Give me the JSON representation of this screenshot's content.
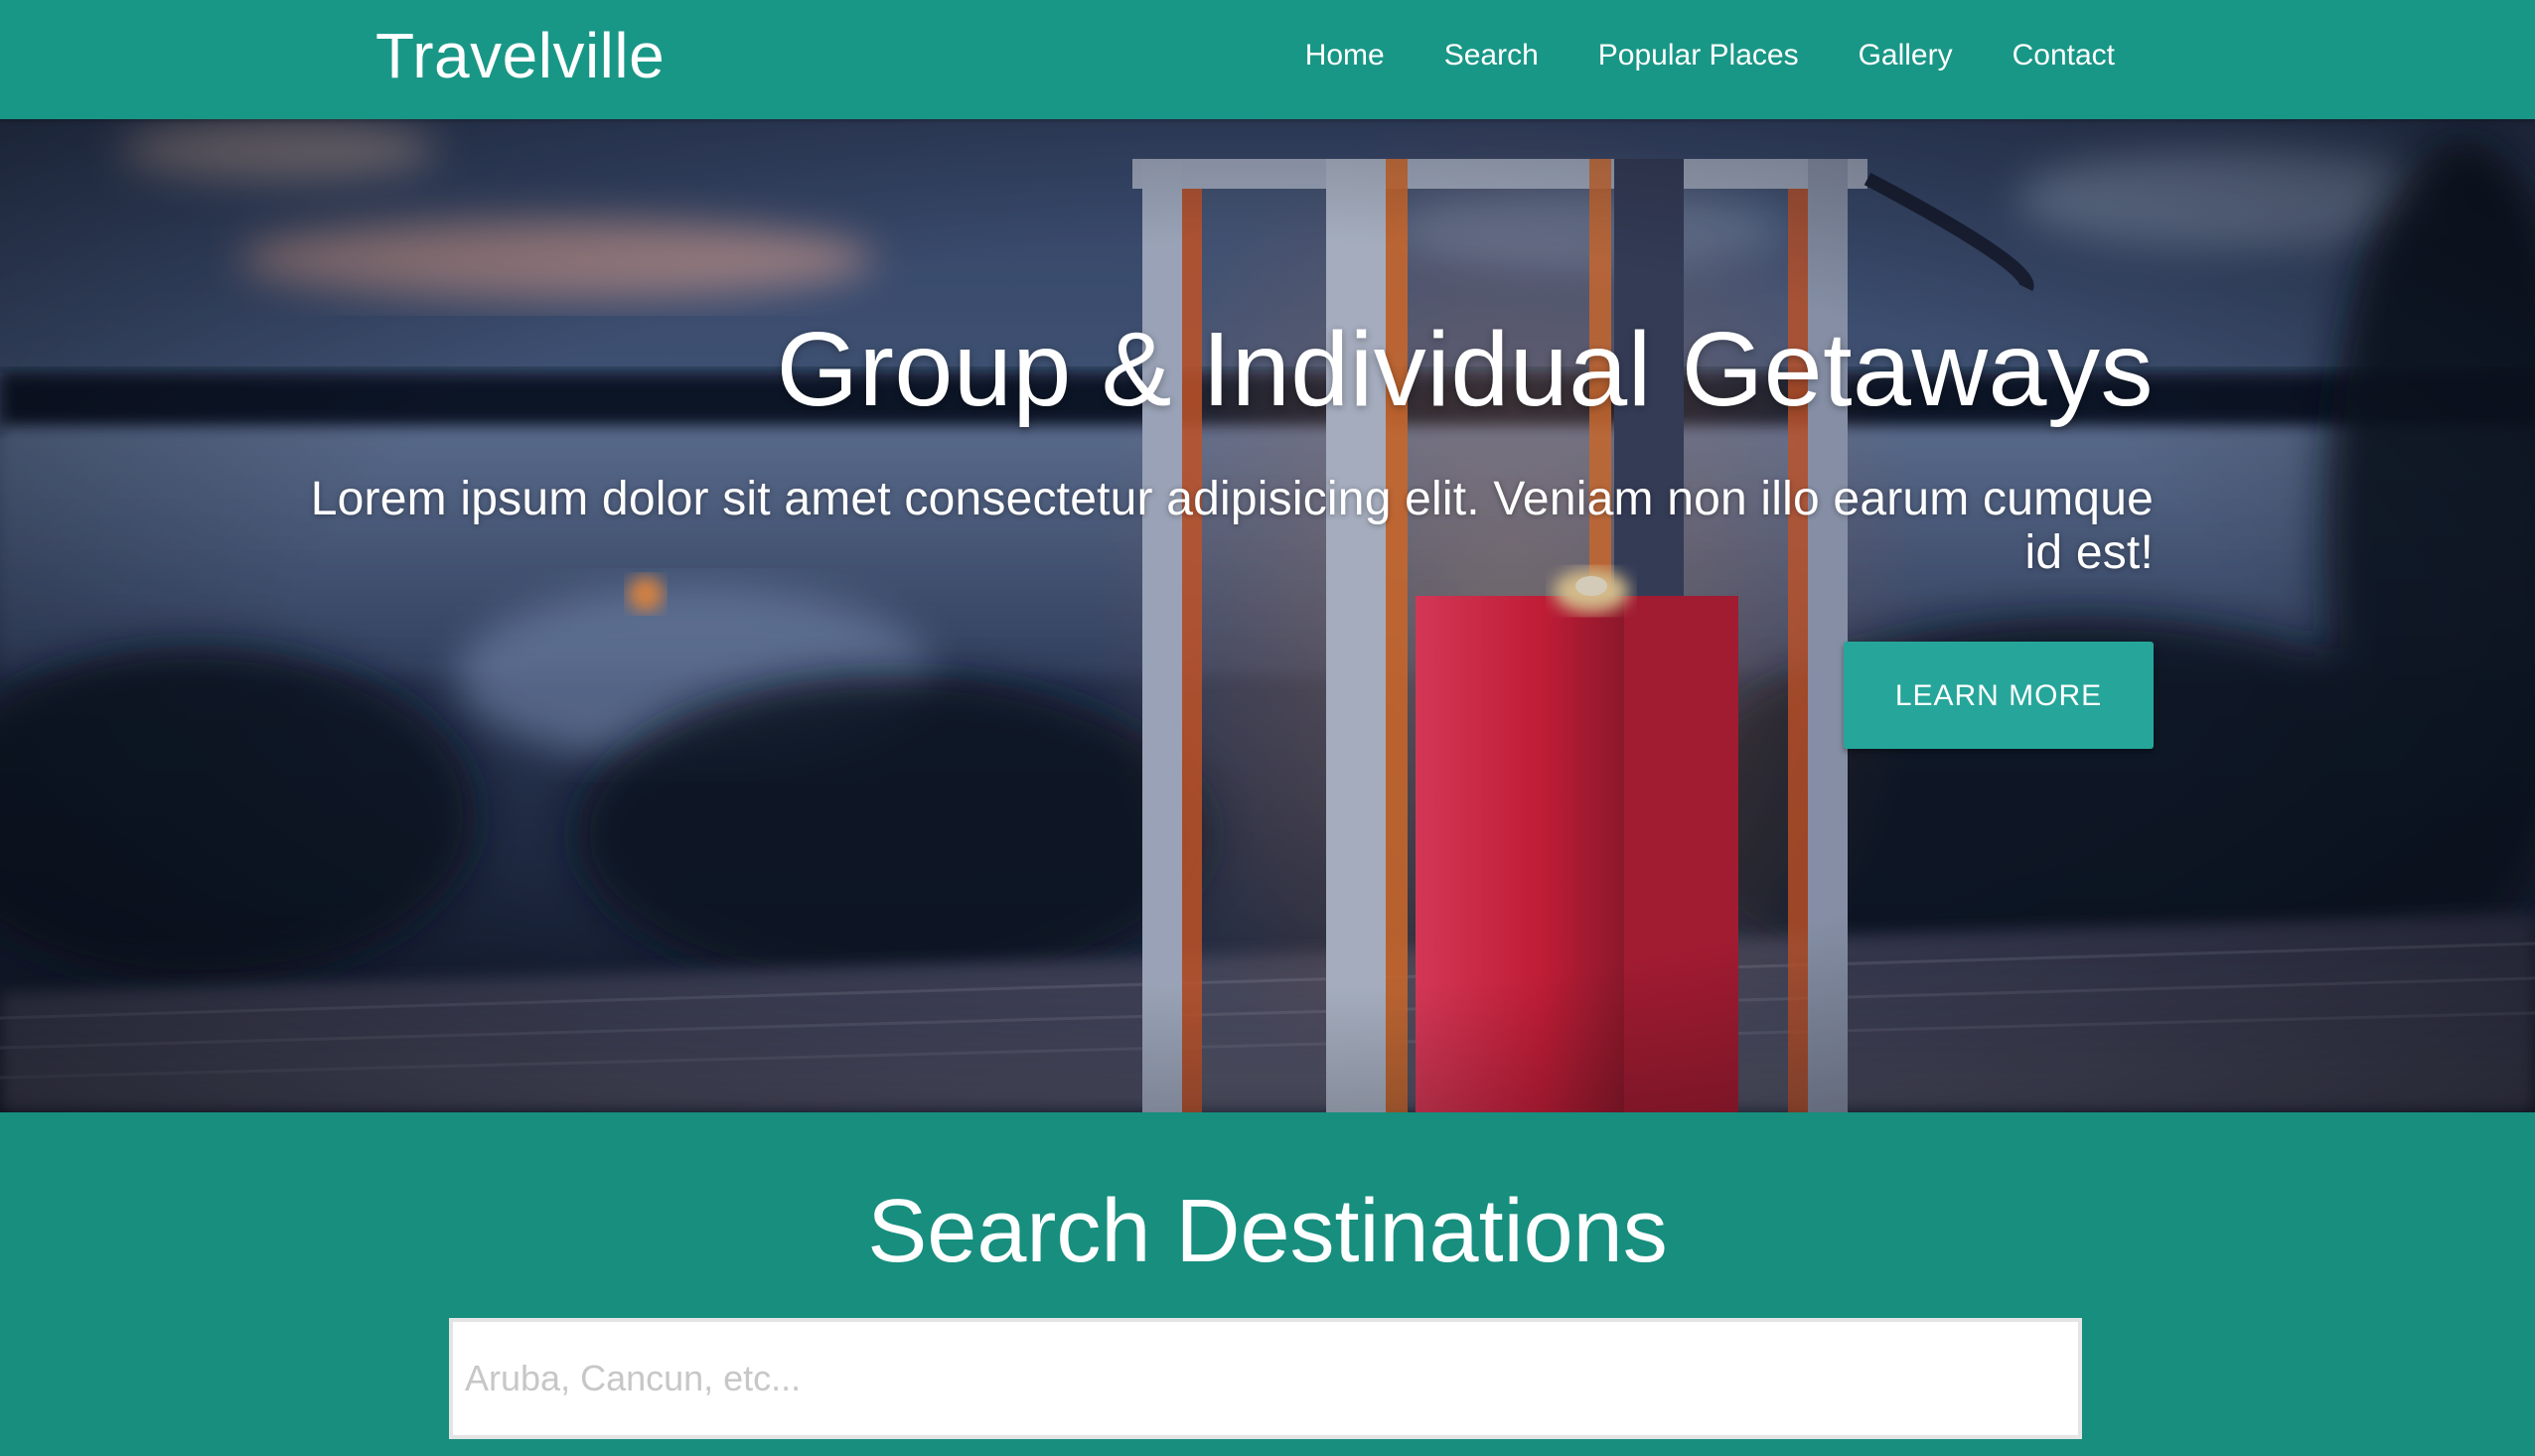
{
  "app": {
    "brand": "Travelville"
  },
  "nav": {
    "items": [
      {
        "label": "Home"
      },
      {
        "label": "Search"
      },
      {
        "label": "Popular Places"
      },
      {
        "label": "Gallery"
      },
      {
        "label": "Contact"
      }
    ]
  },
  "hero": {
    "title": "Group & Individual Getaways",
    "subtitle": "Lorem ipsum dolor sit amet consectetur adipisicing elit. Veniam non illo earum cumque id est!",
    "cta_label": "LEARN MORE"
  },
  "search": {
    "title": "Search Destinations",
    "placeholder": "Aruba, Cancun, etc...",
    "value": ""
  },
  "colors": {
    "navbar": "#199786",
    "section": "#178e7e",
    "button": "#26a69a",
    "text": "#ffffff"
  }
}
